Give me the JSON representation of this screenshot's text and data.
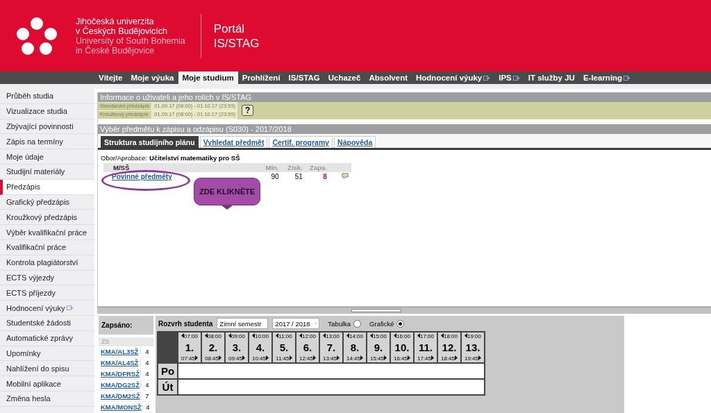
{
  "header": {
    "university_lines": [
      "Jihočeská univerzita",
      "v Českých Budějovicích",
      "University of South Bohemia",
      "in České Budějovice"
    ],
    "portal_title": "Portál",
    "portal_subtitle": "IS/STAG"
  },
  "nav": [
    {
      "label": "Vítejte",
      "selected": false,
      "external": false
    },
    {
      "label": "Moje výuka",
      "selected": false,
      "external": false
    },
    {
      "label": "Moje studium",
      "selected": true,
      "external": false
    },
    {
      "label": "Prohlížení",
      "selected": false,
      "external": false
    },
    {
      "label": "IS/STAG",
      "selected": false,
      "external": false
    },
    {
      "label": "Uchazeč",
      "selected": false,
      "external": false
    },
    {
      "label": "Absolvent",
      "selected": false,
      "external": false
    },
    {
      "label": "Hodnocení výuky",
      "selected": false,
      "external": true
    },
    {
      "label": "IPS",
      "selected": false,
      "external": true
    },
    {
      "label": "IT služby JU",
      "selected": false,
      "external": false
    },
    {
      "label": "E-learning",
      "selected": false,
      "external": true
    }
  ],
  "sidebar": [
    {
      "label": "Průběh studia",
      "selected": false,
      "external": false
    },
    {
      "label": "Vizualizace studia",
      "selected": false,
      "external": false
    },
    {
      "label": "Zbývající povinnosti",
      "selected": false,
      "external": false
    },
    {
      "label": "Zápis na termíny",
      "selected": false,
      "external": false
    },
    {
      "label": "Moje údaje",
      "selected": false,
      "external": false
    },
    {
      "label": "Studijní materiály",
      "selected": false,
      "external": false
    },
    {
      "label": "Předzápis",
      "selected": true,
      "external": false
    },
    {
      "label": "Grafický předzápis",
      "selected": false,
      "external": false
    },
    {
      "label": "Kroužkový předzápis",
      "selected": false,
      "external": false
    },
    {
      "label": "Výběr kvalifikační práce",
      "selected": false,
      "external": false
    },
    {
      "label": "Kvalifikační práce",
      "selected": false,
      "external": false
    },
    {
      "label": "Kontrola plagiátorství",
      "selected": false,
      "external": false
    },
    {
      "label": "ECTS výjezdy",
      "selected": false,
      "external": false
    },
    {
      "label": "ECTS příjezdy",
      "selected": false,
      "external": false
    },
    {
      "label": "Hodnocení výuky",
      "selected": false,
      "external": true
    },
    {
      "label": "Studentské žádosti",
      "selected": false,
      "external": false
    },
    {
      "label": "Automatické zprávy",
      "selected": false,
      "external": false
    },
    {
      "label": "Upomínky",
      "selected": false,
      "external": false
    },
    {
      "label": "Nahlížení do spisu",
      "selected": false,
      "external": false
    },
    {
      "label": "Mobilní aplikace",
      "selected": false,
      "external": false
    },
    {
      "label": "Změna hesla",
      "selected": false,
      "external": false
    }
  ],
  "info_panel": {
    "title": "Informace o uživateli a jeho rolích v IS/STAG",
    "rows": [
      {
        "label": "Standardní předzápis",
        "value": "01.09.17 (08:00) - 01.10.17 (23:59)"
      },
      {
        "label": "Kroužkový předzápis",
        "value": "01.09.17 (08:00) - 01.10.17 (23:59)"
      }
    ],
    "help_button": "?"
  },
  "selection_panel": {
    "title": "Výběr předmětu k zápisu a odzápisu (S030) - 2017/2018",
    "tabs": [
      {
        "label": "Struktura studijního plánu",
        "selected": true
      },
      {
        "label": "Vyhledat předmět",
        "selected": false
      },
      {
        "label": "Certif. programy",
        "selected": false
      },
      {
        "label": "Nápověda",
        "selected": false
      }
    ],
    "field_label": "Obor/Aprobace:",
    "field_value": "Učitelství matematiky pro SŠ",
    "plan": {
      "heading": "M/SŠ",
      "columns": [
        "Min.",
        "Získ.",
        "Zaps."
      ],
      "rows": [
        {
          "name": "Povinné předměty",
          "min": "90",
          "gained": "51",
          "enrolled": "8"
        }
      ]
    },
    "callout": "ZDE KLIKNĚTE"
  },
  "enrolled_panel": {
    "title": "Zapsáno:",
    "group": "ZS",
    "courses": [
      {
        "code": "KMA/AL3SŽ",
        "credits": "4"
      },
      {
        "code": "KMA/AL4SŽ",
        "credits": "4"
      },
      {
        "code": "KMA/DFRSŽ",
        "credits": "4"
      },
      {
        "code": "KMA/DG2SŽ",
        "credits": "4"
      },
      {
        "code": "KMA/DM2SŽ",
        "credits": "7"
      },
      {
        "code": "KMA/MONSŽ",
        "credits": "4"
      }
    ]
  },
  "schedule": {
    "title": "Rozvrh studenta",
    "semester": "Zimní semestr",
    "year": "2017 / 2018",
    "views": [
      {
        "label": "Tabulka",
        "selected": false
      },
      {
        "label": "Grafické",
        "selected": true
      }
    ],
    "periods": [
      {
        "start": "07:00",
        "number": "1.",
        "end": "07:45"
      },
      {
        "start": "08:00",
        "number": "2.",
        "end": "08:45"
      },
      {
        "start": "09:00",
        "number": "3.",
        "end": "09:45"
      },
      {
        "start": "10:00",
        "number": "4.",
        "end": "10:45"
      },
      {
        "start": "11:00",
        "number": "5.",
        "end": "11:45"
      },
      {
        "start": "12:00",
        "number": "6.",
        "end": "12:45"
      },
      {
        "start": "13:00",
        "number": "7.",
        "end": "13:45"
      },
      {
        "start": "14:00",
        "number": "8.",
        "end": "14:45"
      },
      {
        "start": "15:00",
        "number": "9.",
        "end": "15:45"
      },
      {
        "start": "16:00",
        "number": "10.",
        "end": "16:45"
      },
      {
        "start": "17:00",
        "number": "11.",
        "end": "17:45"
      },
      {
        "start": "18:00",
        "number": "12.",
        "end": "18:45"
      },
      {
        "start": "19:00",
        "number": "13.",
        "end": "19:45"
      }
    ],
    "days": [
      "Po",
      "Út"
    ]
  }
}
